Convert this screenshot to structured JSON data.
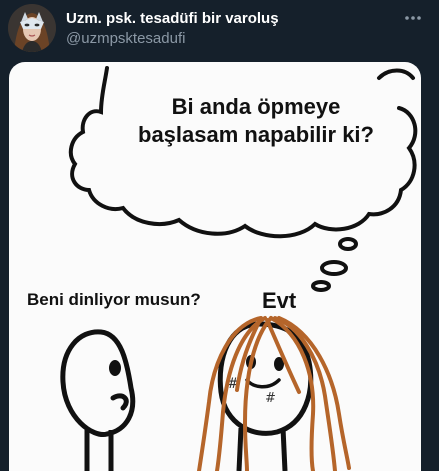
{
  "tweet": {
    "display_name": "Uzm. psk. tesadüfi bir varoluş",
    "handle": "@uzmpsktesadufi",
    "avatar_icon": "masked-woman-avatar",
    "more_icon": "more-options-icon"
  },
  "meme": {
    "thought_line1": "Bi anda öpmeye",
    "thought_line2": "başlasam napabilir ki?",
    "speech_left": "Beni dinliyor musun?",
    "reply_right": "Evt"
  },
  "colors": {
    "background": "#15202b",
    "text_primary": "#ffffff",
    "text_secondary": "#8b98a5",
    "media_bg": "#fbfbfb",
    "hair": "#b5652a"
  }
}
